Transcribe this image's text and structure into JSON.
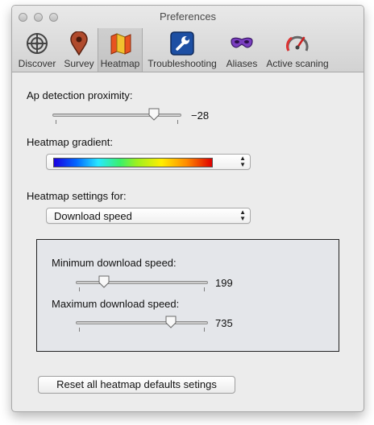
{
  "window": {
    "title": "Preferences"
  },
  "toolbar": {
    "tabs": [
      {
        "id": "discover",
        "label": "Discover",
        "icon": "crosshair-icon",
        "selected": false
      },
      {
        "id": "survey",
        "label": "Survey",
        "icon": "map-pin-icon",
        "selected": false
      },
      {
        "id": "heatmap",
        "label": "Heatmap",
        "icon": "heatmap-map-icon",
        "selected": true
      },
      {
        "id": "troubleshooting",
        "label": "Troubleshooting",
        "icon": "wrench-icon",
        "selected": false
      },
      {
        "id": "aliases",
        "label": "Aliases",
        "icon": "mask-icon",
        "selected": false
      },
      {
        "id": "active_scanning",
        "label": "Active scaning",
        "icon": "gauge-icon",
        "selected": false
      }
    ]
  },
  "heatmap": {
    "ap_detection": {
      "label": "Ap detection proximity:",
      "value": "−28",
      "level": 0.8
    },
    "gradient": {
      "label": "Heatmap gradient:"
    },
    "settings_for": {
      "label": "Heatmap settings for:",
      "selected": "Download speed"
    },
    "min_speed": {
      "label": "Minimum download speed:",
      "value": "199",
      "level": 0.2
    },
    "max_speed": {
      "label": "Maximum download speed:",
      "value": "735",
      "level": 0.73
    },
    "reset_label": "Reset all heatmap defaults setings"
  },
  "colors": {
    "accent_blue": "#1d4fa3",
    "window_bg": "#ececec",
    "group_bg": "#e4e6ea"
  }
}
